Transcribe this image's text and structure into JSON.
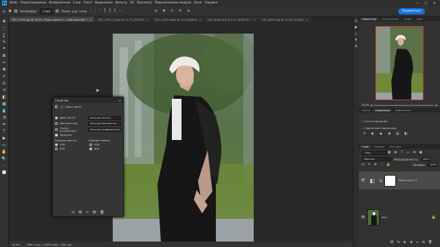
{
  "app": {
    "logo": "Ps"
  },
  "menu": [
    "Файл",
    "Редактирование",
    "Изображение",
    "Слои",
    "Текст",
    "Выделение",
    "Фильтр",
    "3D",
    "Просмотр",
    "Подключаемые модули",
    "Окно",
    "Справка"
  ],
  "window_controls": [
    "—",
    "▢",
    "✕"
  ],
  "options_bar": {
    "autoselect_label": "Автовыбор:",
    "autoselect_value": "Слой",
    "transform_label": "Показ. упр. элем.",
    "share_label": "Поделиться"
  },
  "tabs": [
    {
      "label": "DSC_9749.jpg @ 16,5% (Поиск цвета 1, Слой-маска/8) *",
      "active": true
    },
    {
      "label": "DSC_5295_1.jpeg @ 14,7% (RGB/8)",
      "active": false
    },
    {
      "label": "DSC_4255.webp @ 15% (RGB/8)",
      "active": false
    },
    {
      "label": "DSC_8460.psd @ 21% (RGB/16) *",
      "active": false
    },
    {
      "label": "DSC_8600.jpg @ 16,5% (RGB/8)",
      "active": false
    }
  ],
  "tools": [
    "move-icon",
    "marquee-icon",
    "lasso-icon",
    "quick-select-icon",
    "crop-icon",
    "frame-icon",
    "eyedropper-icon",
    "healing-icon",
    "brush-icon",
    "stamp-icon",
    "history-brush-icon",
    "eraser-icon",
    "gradient-icon",
    "blur-icon",
    "dodge-icon",
    "pen-icon",
    "type-icon",
    "path-select-icon",
    "rectangle-icon",
    "hand-icon",
    "zoom-icon",
    "more-icon"
  ],
  "tool_glyphs": [
    "✥",
    "⬚",
    "ʆ",
    "✎",
    "⌗",
    "⊠",
    "✑",
    "✚",
    "✐",
    "♙",
    "↺",
    "◧",
    "▦",
    "💧",
    "◔",
    "✒",
    "T",
    "▶",
    "▭",
    "✋",
    "🔍",
    "⋯"
  ],
  "properties": {
    "title": "Свойства",
    "subtitle": "Поиск цвета",
    "file_3dlut_label": "Файл 3DLUT",
    "file_3dlut_value": "Загрузка 3D LUT...",
    "abstract_label": "Абстрактный",
    "abstract_value": "Загрузка Абстрактна...",
    "device_link_label": "Связь с устройством",
    "device_link_value": "Загрузка профиля Device...",
    "dither_label": "Дизеринг",
    "data_order_label": "Порядок данных",
    "table_order_label": "Порядок таблиц",
    "rgb1": "RGB",
    "bgr1": "BGR",
    "rgb2": "RGB",
    "bgr2": "BGR",
    "footer_icons": [
      "⊡",
      "👁",
      "↶",
      "👁",
      "🗑"
    ]
  },
  "status": {
    "zoom": "16,5%",
    "doc": "3887 пикс. x 5838 пикс. (300 ppi)"
  },
  "right_panel": {
    "nav_tabs": [
      "Навигатор",
      "Гистограмма",
      "Инфо",
      "Цвет"
    ],
    "zoom_value": "16,5%",
    "props_tabs": [
      "Кисти",
      "Коррекция",
      "Библиотеки"
    ],
    "corr_items": [
      "Стили коррекции",
      "Одиночные коррекции"
    ],
    "layer_tabs": [
      "Слои",
      "Каналы",
      "Контуры"
    ],
    "blend_mode": "Обычные",
    "opacity_label": "Непрозрачность:",
    "opacity": "100%",
    "fill_label": "Заливка:",
    "fill": "100%",
    "layers": [
      {
        "name": "Поиск цвета 1"
      },
      {
        "name": "Фон"
      }
    ],
    "bottom_icons": [
      "⛓",
      "fx",
      "◐",
      "◑",
      "▭",
      "⊞",
      "🗑"
    ]
  }
}
